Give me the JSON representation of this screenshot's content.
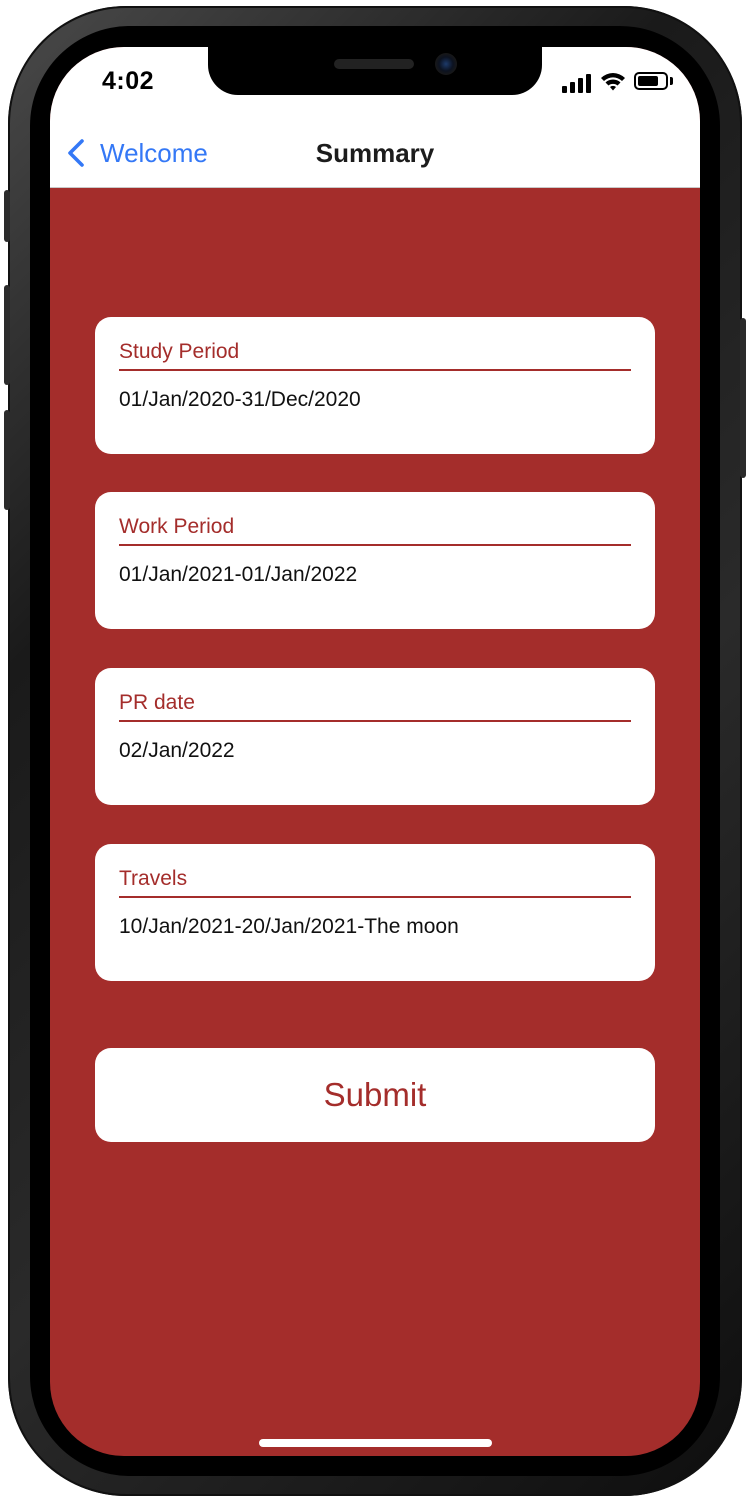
{
  "status_bar": {
    "time": "4:02"
  },
  "nav": {
    "back_label": "Welcome",
    "title": "Summary"
  },
  "cards": [
    {
      "label": "Study Period",
      "value": "01/Jan/2020-31/Dec/2020"
    },
    {
      "label": "Work Period",
      "value": "01/Jan/2021-01/Jan/2022"
    },
    {
      "label": "PR date",
      "value": "02/Jan/2022"
    },
    {
      "label": "Travels",
      "value": "10/Jan/2021-20/Jan/2021-The moon"
    }
  ],
  "submit_label": "Submit",
  "colors": {
    "background": "#a42d2b",
    "accent_text": "#a42d2b",
    "link": "#3478f6"
  },
  "icons": {
    "back": "chevron-left-icon",
    "signal": "cellular-signal-icon",
    "wifi": "wifi-icon",
    "battery": "battery-icon"
  }
}
